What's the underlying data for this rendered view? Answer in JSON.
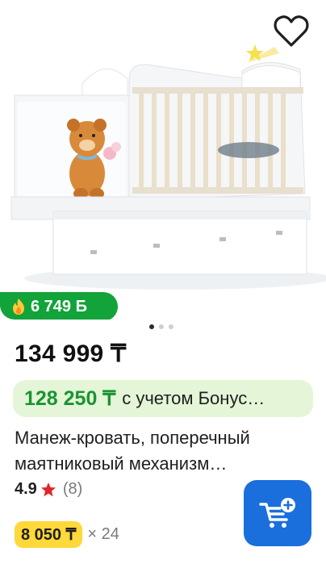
{
  "product": {
    "bonus_amount": "6 749 Б",
    "price": "134 999 ₸",
    "bonus_price": "128 250 ₸",
    "bonus_note": "с учетом Бонус…",
    "title": "Манеж-кровать, поперечный маятниковый механизм…",
    "rating": "4.9",
    "review_count": "(8)",
    "installment_amount": "8 050 ₸",
    "installment_term": "× 24"
  },
  "gallery": {
    "dot_count": 3,
    "active_index": 0
  },
  "icons": {
    "favorite": "heart-outline-icon",
    "bonus": "flame-icon",
    "rating": "star-icon",
    "cart": "cart-add-icon"
  },
  "colors": {
    "bonus_green": "#12a33a",
    "bonus_price_green": "#1a9433",
    "bonus_bg": "#e4f6d7",
    "star_red": "#e0262b",
    "cart_blue": "#1a6fdc",
    "installment_yellow": "#ffd83a"
  }
}
